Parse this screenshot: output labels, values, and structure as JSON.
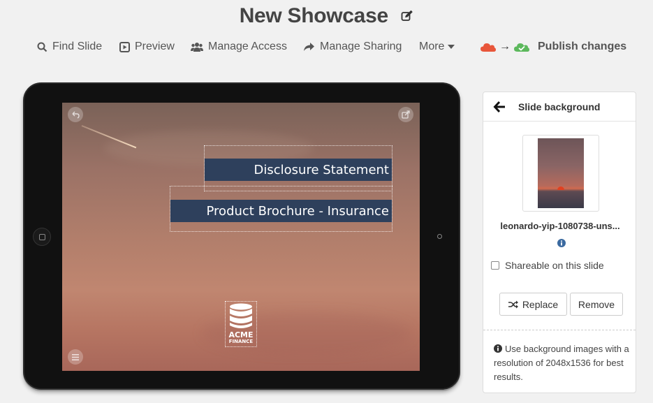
{
  "header": {
    "title": "New Showcase",
    "edit_icon": "edit-icon"
  },
  "toolbar": {
    "find_slide": "Find Slide",
    "preview": "Preview",
    "manage_access": "Manage Access",
    "manage_sharing": "Manage Sharing",
    "more": "More",
    "publish_arrow": "→",
    "publish": "Publish changes"
  },
  "slide": {
    "buttons": [
      {
        "label": "Disclosure Statement"
      },
      {
        "label": "Product Brochure - Insurance"
      }
    ],
    "logo": {
      "line1": "ACME",
      "line2": "FINANCE"
    }
  },
  "panel": {
    "title": "Slide background",
    "filename": "leonardo-yip-1080738-uns...",
    "shareable_label": "Shareable on this slide",
    "shareable_checked": false,
    "replace_label": "Replace",
    "remove_label": "Remove",
    "hint": "Use background images with a resolution of 2048x1536 for best results."
  },
  "colors": {
    "accent_button": "#2e405c",
    "cloud_out": "#e8563a",
    "cloud_in": "#5cb85c"
  }
}
